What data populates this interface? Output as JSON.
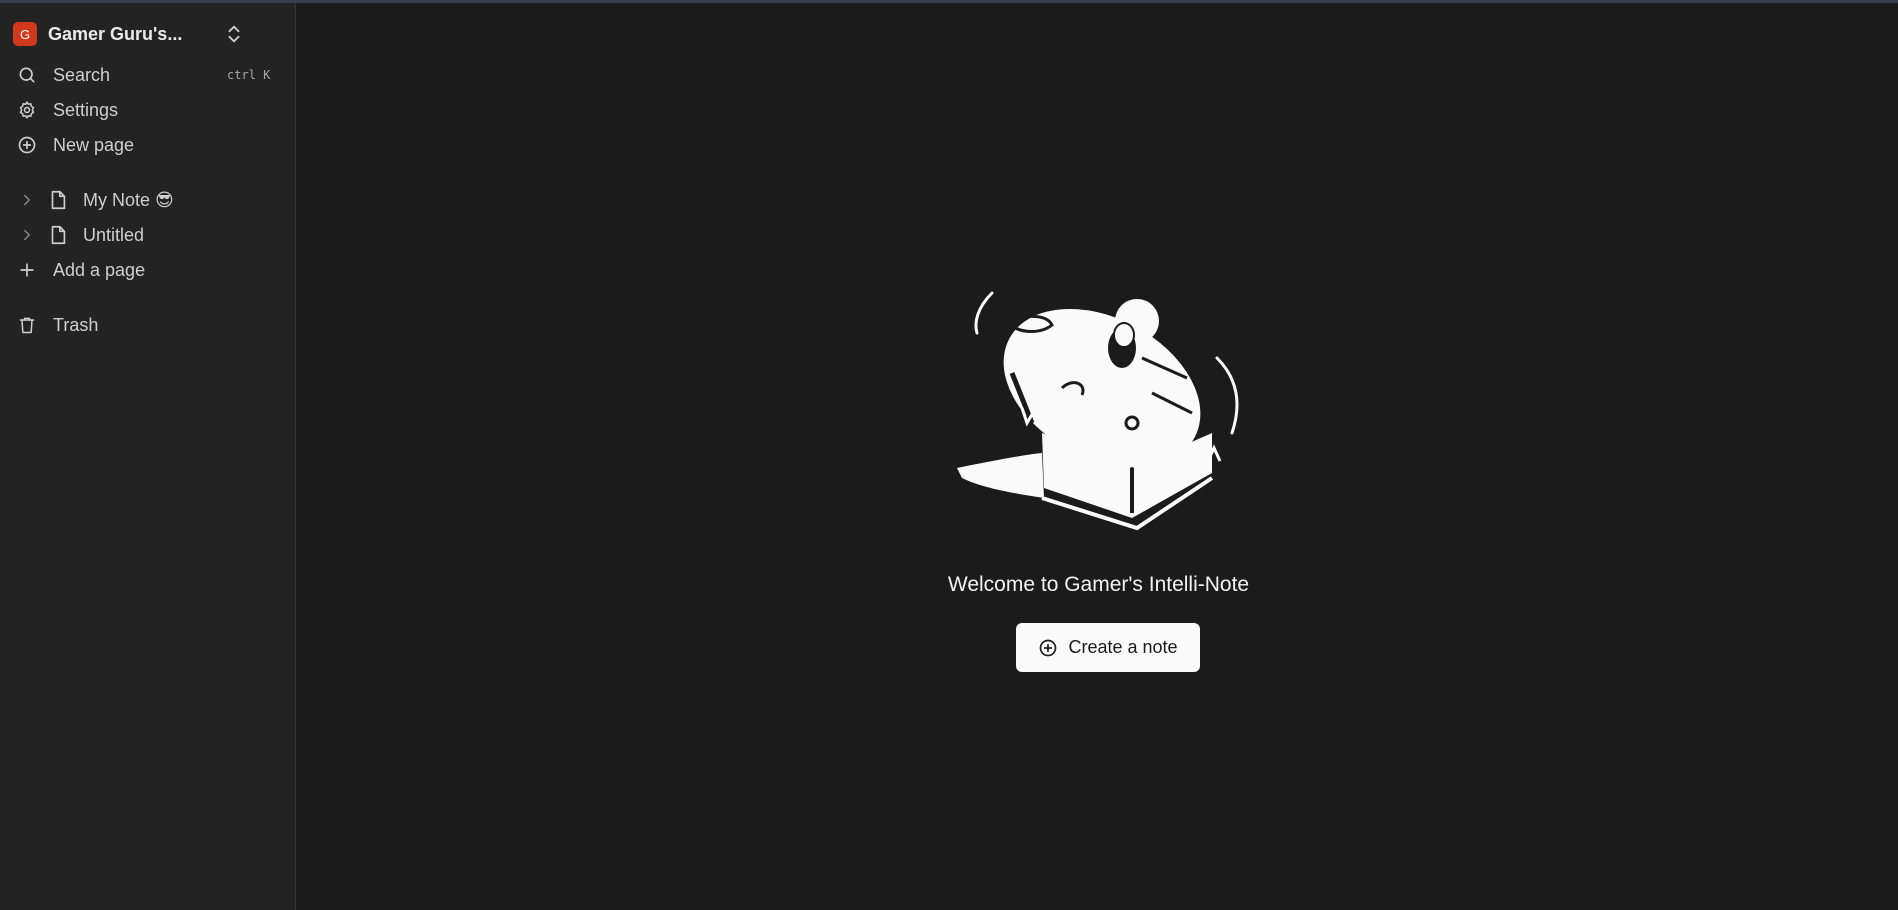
{
  "sidebar": {
    "workspace": {
      "initial": "G",
      "name": "Gamer Guru's...",
      "avatar_color": "#d2381b"
    },
    "search": {
      "label": "Search",
      "shortcut": "ctrl K",
      "icon": "search-icon"
    },
    "settings": {
      "label": "Settings",
      "icon": "gear-icon"
    },
    "new_page": {
      "label": "New page",
      "icon": "plus-circle-icon"
    },
    "documents": [
      {
        "label": "My Note",
        "emoji": "😎",
        "icon": "file-icon"
      },
      {
        "label": "Untitled",
        "emoji": "",
        "icon": "file-icon"
      }
    ],
    "add_page": {
      "label": "Add a page",
      "icon": "plus-icon"
    },
    "trash": {
      "label": "Trash",
      "icon": "trash-icon"
    }
  },
  "main": {
    "welcome_text": "Welcome to Gamer's Intelli-Note",
    "create_button": {
      "label": "Create a note",
      "icon": "plus-circle-icon"
    }
  },
  "colors": {
    "sidebar_bg": "#232323",
    "main_bg": "#1b1b1b",
    "button_bg": "#fafafa"
  }
}
